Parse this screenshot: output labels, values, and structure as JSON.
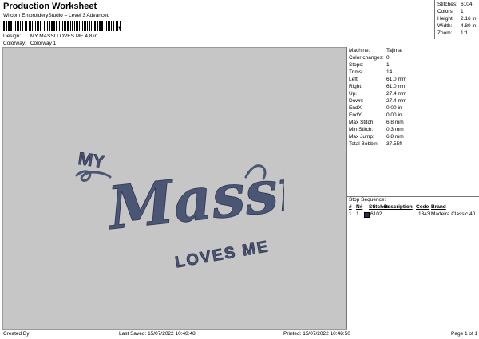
{
  "header": {
    "title": "Production Worksheet",
    "subtitle": "Wilcom EmbroideryStudio – Level 3 Advanced",
    "barcode_glyph": "barcode",
    "design_label": "Design:",
    "design_value": "MY MASSI LOVES ME 4,8 in",
    "colorway_label": "Colorway:",
    "colorway_value": "Colorway 1"
  },
  "stats": [
    {
      "label": "Stitches:",
      "value": "6104"
    },
    {
      "label": "Colors:",
      "value": "1"
    },
    {
      "label": "Height:",
      "value": "2.16 in"
    },
    {
      "label": "Width:",
      "value": "4.80 in"
    },
    {
      "label": "Zoom:",
      "value": "1:1"
    }
  ],
  "artwork": {
    "text_line1": "MY",
    "text_line2": "Massi",
    "text_line3": "LOVES ME",
    "thread_color": "#4b5674"
  },
  "machine_info": [
    {
      "label": "Machine:",
      "value": "Tajima"
    },
    {
      "label": "Color changes:",
      "value": "0"
    },
    {
      "label": "Stops:",
      "value": "1"
    },
    {
      "label": "Trims:",
      "value": "14"
    },
    {
      "label": "Left:",
      "value": "61.0 mm"
    },
    {
      "label": "Right:",
      "value": "61.0 mm"
    },
    {
      "label": "Up:",
      "value": "27.4 mm"
    },
    {
      "label": "Down:",
      "value": "27.4 mm"
    },
    {
      "label": "EndX:",
      "value": "0.00 in"
    },
    {
      "label": "EndY:",
      "value": "0.00 in"
    },
    {
      "label": "Max Stitch:",
      "value": "6.8 mm"
    },
    {
      "label": "Min Stitch:",
      "value": "0.3 mm"
    },
    {
      "label": "Max Jump:",
      "value": "6.8 mm"
    },
    {
      "label": "Total Bobbin:",
      "value": "37.55ft"
    }
  ],
  "stop_sequence": {
    "title": "Stop Sequence:",
    "columns": [
      "#",
      "N#",
      "Stitches",
      "Description",
      "Code",
      "Brand"
    ],
    "rows": [
      {
        "num": "1",
        "n": "1",
        "stitches": "6102",
        "description": "",
        "code": "1343",
        "brand": "Madeira Classic 40",
        "color": "#2a2d4a"
      }
    ]
  },
  "footer": {
    "created_by": "Created By:",
    "last_saved": "Last Saved: 15/07/2022 10:48:48",
    "printed": "Printed: 15/07/2022 10:48:50",
    "page": "Page 1 of 1"
  }
}
